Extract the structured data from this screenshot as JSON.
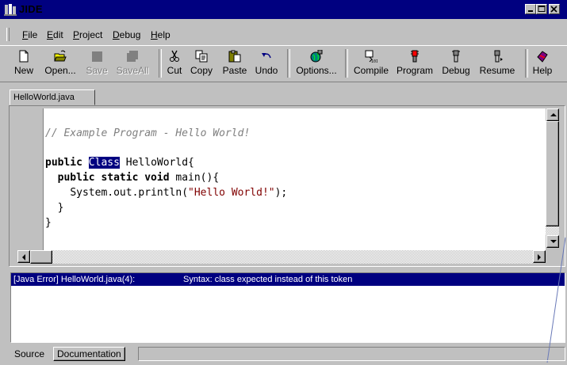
{
  "window": {
    "title": "JIDE"
  },
  "menu": {
    "items": [
      "File",
      "Edit",
      "Project",
      "Debug",
      "Help"
    ],
    "mnemonics": [
      "F",
      "E",
      "P",
      "D",
      "H"
    ]
  },
  "toolbar": {
    "buttons": [
      {
        "label": "New",
        "icon": "new-file-icon",
        "enabled": true
      },
      {
        "label": "Open...",
        "icon": "open-folder-icon",
        "enabled": true
      },
      {
        "label": "Save",
        "icon": "save-disk-icon",
        "enabled": false
      },
      {
        "label": "SaveAll",
        "icon": "save-all-icon",
        "enabled": false
      },
      {
        "label": "Cut",
        "icon": "scissors-icon",
        "enabled": true
      },
      {
        "label": "Copy",
        "icon": "copy-icon",
        "enabled": true
      },
      {
        "label": "Paste",
        "icon": "paste-clipboard-icon",
        "enabled": true
      },
      {
        "label": "Undo",
        "icon": "undo-arrow-icon",
        "enabled": true
      },
      {
        "label": "Options...",
        "icon": "options-globe-icon",
        "enabled": true
      },
      {
        "label": "Compile",
        "icon": "compile-icon",
        "enabled": true
      },
      {
        "label": "Program",
        "icon": "program-run-icon",
        "enabled": true
      },
      {
        "label": "Debug",
        "icon": "debug-icon",
        "enabled": true
      },
      {
        "label": "Resume",
        "icon": "resume-icon",
        "enabled": true
      },
      {
        "label": "Help",
        "icon": "help-book-icon",
        "enabled": true
      }
    ]
  },
  "editor": {
    "tab_label": "HelloWorld.java",
    "comment": "// Example Program - Hello World!",
    "line2_keyword": "public",
    "line2_selected": "Class",
    "line2_rest": "HelloWorld{",
    "line3_keywords": "public static void",
    "line3_rest": "main(){",
    "line4_prefix": "System.out.println(",
    "line4_string": "\"Hello World!\"",
    "line4_suffix": ");",
    "line5": "}",
    "line6": "}"
  },
  "output": {
    "error_location": "[Java Error] HelloWorld.java(4):",
    "error_message": "Syntax: class expected instead of this token"
  },
  "bottom_tabs": {
    "source": "Source",
    "documentation": "Documentation"
  },
  "colors": {
    "titlebar": "#000080",
    "selection": "#000080",
    "string": "#800000",
    "comment": "#808080",
    "face": "#c0c0c0"
  }
}
